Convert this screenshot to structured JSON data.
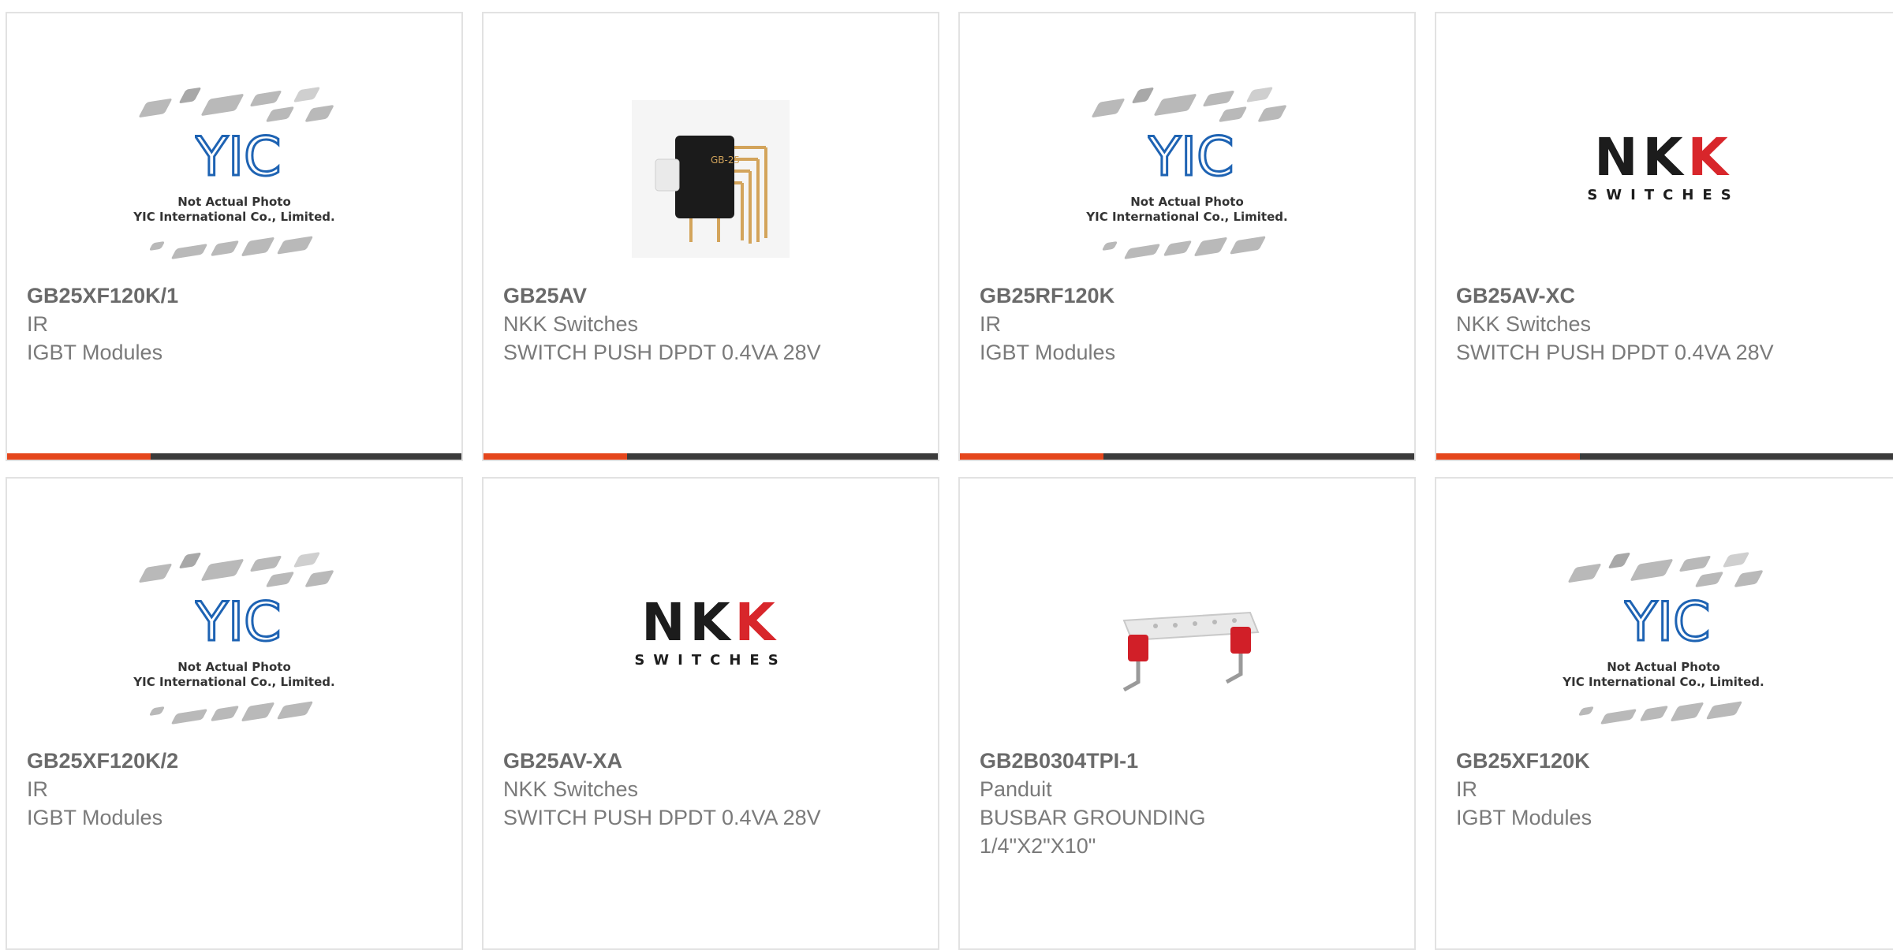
{
  "products": [
    {
      "part": "GB25XF120K/1",
      "manufacturer": "IR",
      "description": "IGBT Modules",
      "image": "placeholder"
    },
    {
      "part": "GB25AV",
      "manufacturer": "NKK Switches",
      "description": "SWITCH PUSH DPDT 0.4VA 28V",
      "image": "switch-photo"
    },
    {
      "part": "GB25RF120K",
      "manufacturer": "IR",
      "description": "IGBT Modules",
      "image": "placeholder"
    },
    {
      "part": "GB25AV-XC",
      "manufacturer": "NKK Switches",
      "description": "SWITCH PUSH DPDT 0.4VA 28V",
      "image": "nkk-logo"
    },
    {
      "part": "GB25XF120K/2",
      "manufacturer": "IR",
      "description": "IGBT Modules",
      "image": "placeholder"
    },
    {
      "part": "GB25AV-XA",
      "manufacturer": "NKK Switches",
      "description": "SWITCH PUSH DPDT 0.4VA 28V",
      "image": "nkk-logo"
    },
    {
      "part": "GB2B0304TPI-1",
      "manufacturer": "Panduit",
      "description": "BUSBAR GROUNDING 1/4\"X2\"X10\"",
      "image": "busbar-photo"
    },
    {
      "part": "GB25XF120K",
      "manufacturer": "IR",
      "description": "IGBT Modules",
      "image": "placeholder"
    }
  ],
  "placeholder": {
    "logo_text": "YIC",
    "line1": "Not Actual Photo",
    "line2": "YIC International Co., Limited."
  },
  "nkk_logo": {
    "big": "NKK",
    "small": "SWITCHES"
  },
  "switch_photo_label": "GB-25",
  "colors": {
    "accent": "#e5461c",
    "bar_dark": "#3b3b3b",
    "yic_blue": "#1e63b3"
  }
}
